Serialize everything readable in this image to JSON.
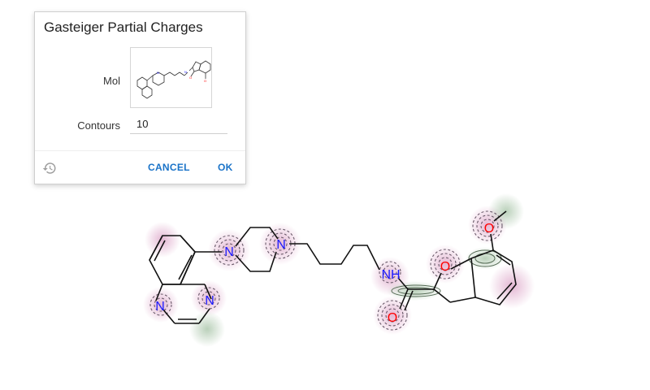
{
  "dialog": {
    "title": "Gasteiger Partial Charges",
    "mol_label": "Mol",
    "contours_label": "Contours",
    "contours_value": "10",
    "cancel_label": "CANCEL",
    "ok_label": "OK"
  },
  "molecule": {
    "atom_labels": {
      "n1": "N",
      "n2": "N",
      "n3": "N",
      "n4": "N",
      "nh": "NH",
      "o_carbonyl": "O",
      "o_ring": "O",
      "o_methoxy": "O"
    }
  },
  "colors": {
    "accent": "#1a73c8",
    "nitrogen": "#1a1aff",
    "oxygen": "#ff0000",
    "negative_charge": "#b03080",
    "positive_charge": "#3a7a3a"
  },
  "icons": {
    "history": "history-icon"
  }
}
